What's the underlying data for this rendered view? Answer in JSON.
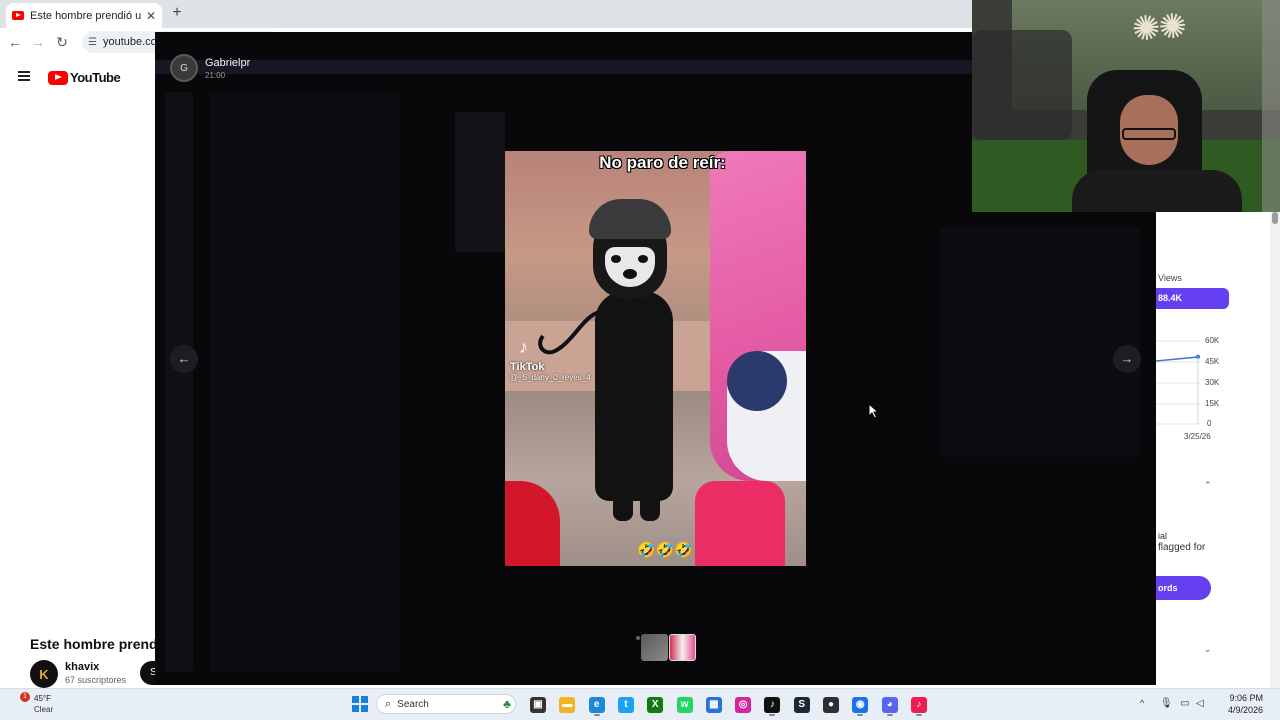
{
  "browser": {
    "tab_title": "Este hombre prendió un almac",
    "tab_close": "✕",
    "new_tab": "+",
    "back": "←",
    "forward": "→",
    "reload": "↻",
    "url": "youtube.com"
  },
  "youtube": {
    "logo_text": "YouTube",
    "video_title": "Este hombre prendió",
    "channel_avatar_letter": "K",
    "channel_name": "khavix",
    "channel_subscribers": "67 suscriptores",
    "subscribe_label": "S"
  },
  "analytics": {
    "views_label": "Views",
    "views_value": "88.4K",
    "y_ticks": [
      "60K",
      "45K",
      "30K",
      "15K",
      "0"
    ],
    "x_date": "3/25/26",
    "policy_line_1": "ial",
    "policy_line_2": "flagged for",
    "records_button": "ords",
    "chevron_up": "⌃",
    "chevron_down": "⌄",
    "accent_color": "#6440f0"
  },
  "discord_viewer": {
    "uploader_name": "Gabrielpr",
    "uploader_time": "21:00",
    "uploader_initials": "G",
    "prev_arrow": "←",
    "next_arrow": "→"
  },
  "video": {
    "caption": "No paro de reír:",
    "tiktok_icon": "♪",
    "tiktok_word": "TikTok",
    "tiktok_handle": "@_5_dany_0_reyes_4",
    "emojis": "🤣🤣🤣"
  },
  "taskbar": {
    "weather_badge": "1",
    "weather_temp": "45°F",
    "weather_condition": "Clear",
    "search_placeholder": "Search",
    "apps": [
      {
        "name": "task-view",
        "glyph": "▣",
        "color": "#333333"
      },
      {
        "name": "file-explorer",
        "glyph": "▬",
        "color": "#f2b422"
      },
      {
        "name": "edge",
        "glyph": "e",
        "color": "#1e88d6"
      },
      {
        "name": "twitter",
        "glyph": "t",
        "color": "#1da1f2"
      },
      {
        "name": "xbox",
        "glyph": "X",
        "color": "#107c10"
      },
      {
        "name": "whatsapp",
        "glyph": "w",
        "color": "#25d366"
      },
      {
        "name": "store",
        "glyph": "▦",
        "color": "#2a73d6"
      },
      {
        "name": "instagram",
        "glyph": "◎",
        "color": "#d6249f"
      },
      {
        "name": "tiktok",
        "glyph": "♪",
        "color": "#111111"
      },
      {
        "name": "steam",
        "glyph": "S",
        "color": "#1b2838"
      },
      {
        "name": "obs",
        "glyph": "●",
        "color": "#302e31"
      },
      {
        "name": "chrome",
        "glyph": "◉",
        "color": "#1a73e8"
      },
      {
        "name": "discord",
        "glyph": "◕",
        "color": "#5865f2"
      },
      {
        "name": "tiktok-studio",
        "glyph": "♪",
        "color": "#ee1d52"
      }
    ],
    "tray_caret": "^",
    "clock_time": "9:06 PM",
    "clock_date": "4/9/2026"
  }
}
